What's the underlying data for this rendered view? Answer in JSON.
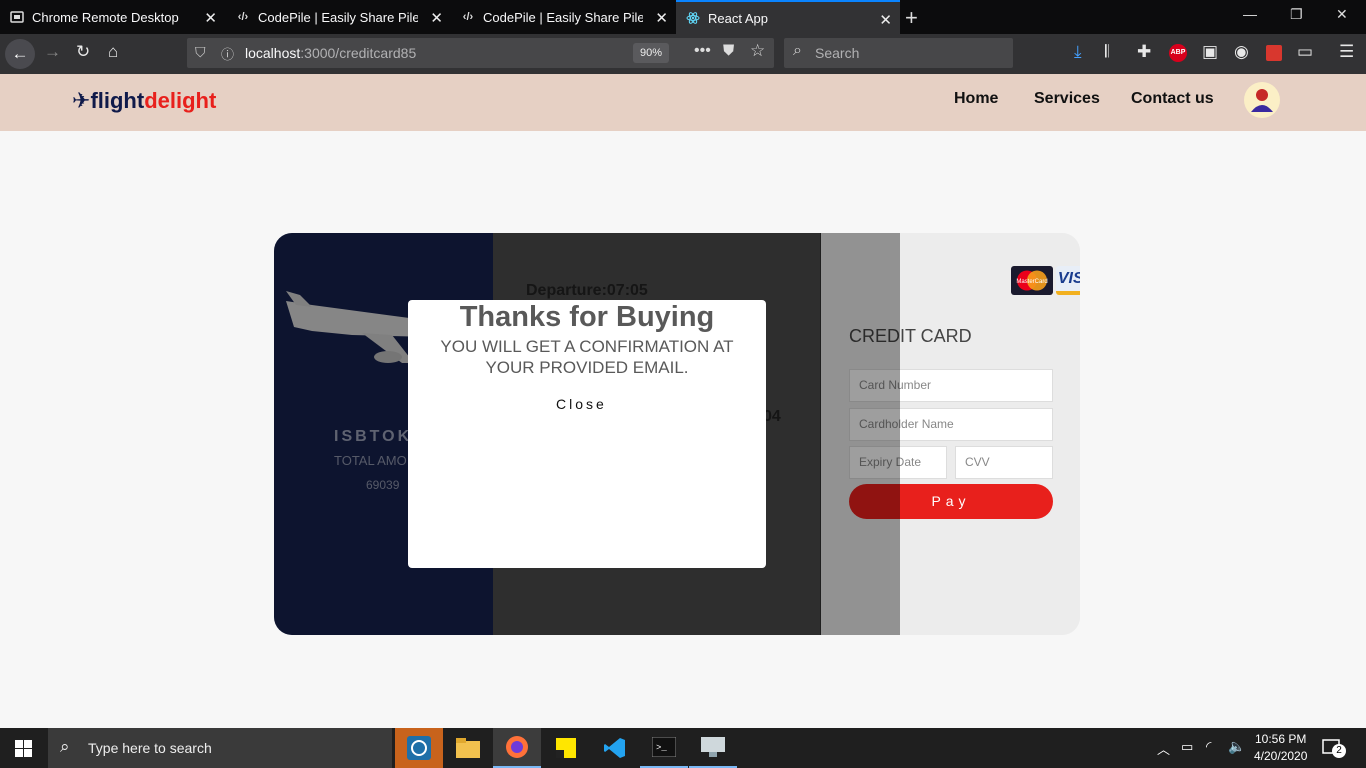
{
  "browser": {
    "tabs": [
      {
        "title": "Chrome Remote Desktop",
        "icon": "remote-desktop-icon"
      },
      {
        "title": "CodePile | Easily Share Piles of",
        "icon": "codepile-icon"
      },
      {
        "title": "CodePile | Easily Share Piles of",
        "icon": "codepile-icon"
      },
      {
        "title": "React App",
        "icon": "react-icon"
      }
    ],
    "url_host": "localhost",
    "url_path": ":3000/creditcard85",
    "zoom": "90%",
    "search_placeholder": "Search",
    "abp_label": "ABP",
    "accent": "#0a84ff"
  },
  "site": {
    "logo_part1": "flight",
    "logo_part2": "delight",
    "nav": [
      "Home",
      "Services",
      "Contact us"
    ],
    "brand_red": "#e8201c",
    "brand_navy": "#101a4a"
  },
  "ticket": {
    "route": "ISBTOK",
    "total_label": "TOTAL AMO",
    "total_value": "69039",
    "departure": "Departure:07:05",
    "arrival_fragment": "04"
  },
  "payment": {
    "title": "CREDIT CARD",
    "card_number_placeholder": "Card Number",
    "cardholder_placeholder": "Cardholder Name",
    "expiry_placeholder": "Expiry Date",
    "cvv_placeholder": "CVV",
    "pay_label": "Pay",
    "mastercard_label": "MasterCard",
    "visa_label": "VISA"
  },
  "modal": {
    "title": "Thanks for Buying",
    "message": "YOU WILL GET A CONFIRMATION AT YOUR PROVIDED EMAIL.",
    "close_label": "Close"
  },
  "taskbar": {
    "search_text": "Type here to search",
    "time": "10:56 PM",
    "date": "4/20/2020",
    "notification_count": "2"
  }
}
